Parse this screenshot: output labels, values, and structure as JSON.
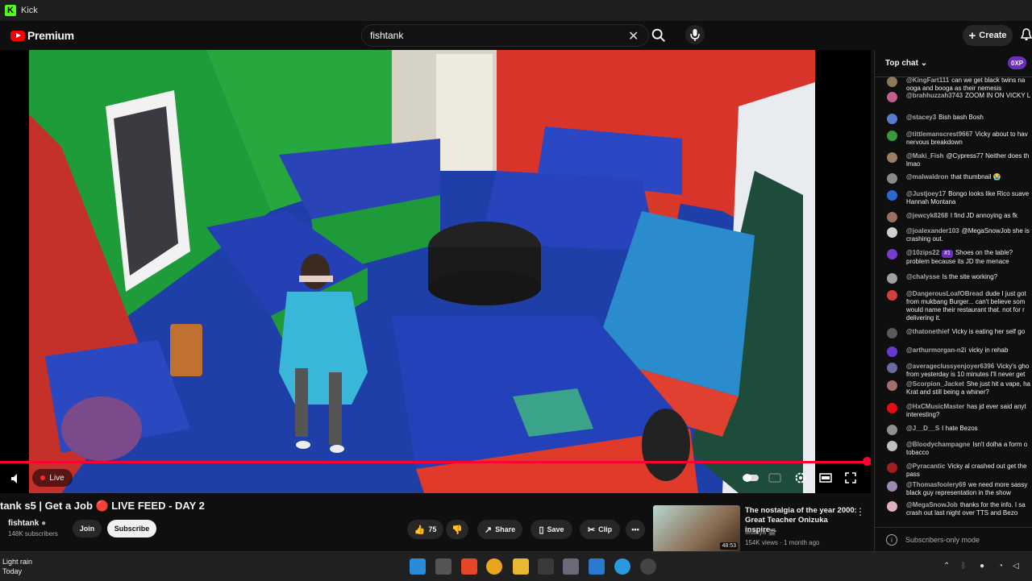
{
  "window": {
    "title": "Kick",
    "logo_letter": "K"
  },
  "masthead": {
    "logo": "Premium",
    "search_value": "fishtank",
    "create_label": "Create"
  },
  "player": {
    "live_label": "Live",
    "progress": 1.0
  },
  "video": {
    "title": "tank s5 | Get a Job 🔴 LIVE FEED - DAY 2",
    "channel": "fishtank",
    "subscribers": "148K subscribers",
    "join_label": "Join",
    "subscribe_label": "Subscribe",
    "likes": "75",
    "share_label": "Share",
    "save_label": "Save",
    "clip_label": "Clip"
  },
  "recommended": {
    "title": "The nostalgia of the year 2000: Great Teacher Onizuka inspire...",
    "channel": "tetauya 🎬",
    "meta": "154K views · 1 month ago",
    "duration": "48:53"
  },
  "chat": {
    "mode": "Top chat",
    "pill": "0XP",
    "footer": "Subscribers-only mode",
    "messages": [
      {
        "author": "@KingFart111",
        "text": "can we get black twins na ooga and booga as their nemesis",
        "color": "#8a7a5a"
      },
      {
        "author": "@brahhuzzah3743",
        "text": "ZOOM IN ON VICKY L",
        "color": "#c06090"
      },
      {
        "author": "@stacey3",
        "text": "Bish bash Bosh",
        "color": "#5a7bd0"
      },
      {
        "author": "@tittlemanscrest9667",
        "text": "Vicky about to hav nervous breakdown",
        "color": "#3a9a3a"
      },
      {
        "author": "@Maki_Fish",
        "text": "@Cypress77 Neither does th lmao",
        "color": "#9a8060"
      },
      {
        "author": "@malwaldron",
        "text": "that thumbnail 😭",
        "color": "#8a8a8a"
      },
      {
        "author": "@Justjoey17",
        "text": "Bongo looks like Rico suave Hannah Montana",
        "color": "#2a6ad0"
      },
      {
        "author": "@jewcyk8268",
        "text": "I find JD annoying as fk",
        "color": "#9a7060"
      },
      {
        "author": "@joalexander103",
        "text": "@MegaSnowJob she is crashing out.",
        "color": "#d0d0d0"
      },
      {
        "author": "@10zips22",
        "badge": "#1",
        "text": "Shoes on the table? problem because its JD the menace",
        "color": "#7a3ad0"
      },
      {
        "author": "@chalysse",
        "text": "Is the site working?",
        "color": "#a0a0a0"
      },
      {
        "author": "@DangerousLoafOBread",
        "text": "dude I just got from mukbang Burger... can't believe som would name their restaurant that. not for r delivering it.",
        "color": "#d04040"
      },
      {
        "author": "@thatonethief",
        "text": "Vicky is eating her self go",
        "color": "#5a5a5a"
      },
      {
        "author": "@arthurmorgan-n2i",
        "text": "vicky in rehab",
        "color": "#6a3ad0"
      },
      {
        "author": "@averageclussyenjoyer6396",
        "text": "Vicky's gho from yesterday is 10 minutes I'll never get",
        "color": "#6a6aa0"
      },
      {
        "author": "@Scorpion_Jacket",
        "text": "She just hit a vape, ha Krat and still being a whiner?",
        "color": "#a07070"
      },
      {
        "author": "@HxCMusicMaster",
        "text": "has jd ever said anyt interesting?",
        "color": "#e01010"
      },
      {
        "author": "@J__D__S",
        "text": "I hate Bezos",
        "color": "#909090"
      },
      {
        "author": "@Bloodychampagne",
        "text": "Isn't dolha a form o tobacco",
        "color": "#c0c0c0"
      },
      {
        "author": "@Pyracantic",
        "text": "Vicky al crashed out get the pass",
        "color": "#a02020"
      },
      {
        "author": "@Thomasfoolery69",
        "text": "we need more sassy black guy representation in the show",
        "color": "#9a8ab0"
      },
      {
        "author": "@MegaSnowJob",
        "text": "thanks for the info. I sa crash out last night over TTS and Bezo",
        "color": "#e0b0c0"
      }
    ]
  },
  "taskbar": {
    "weather_line1": "Light rain",
    "weather_line2": "Today"
  }
}
